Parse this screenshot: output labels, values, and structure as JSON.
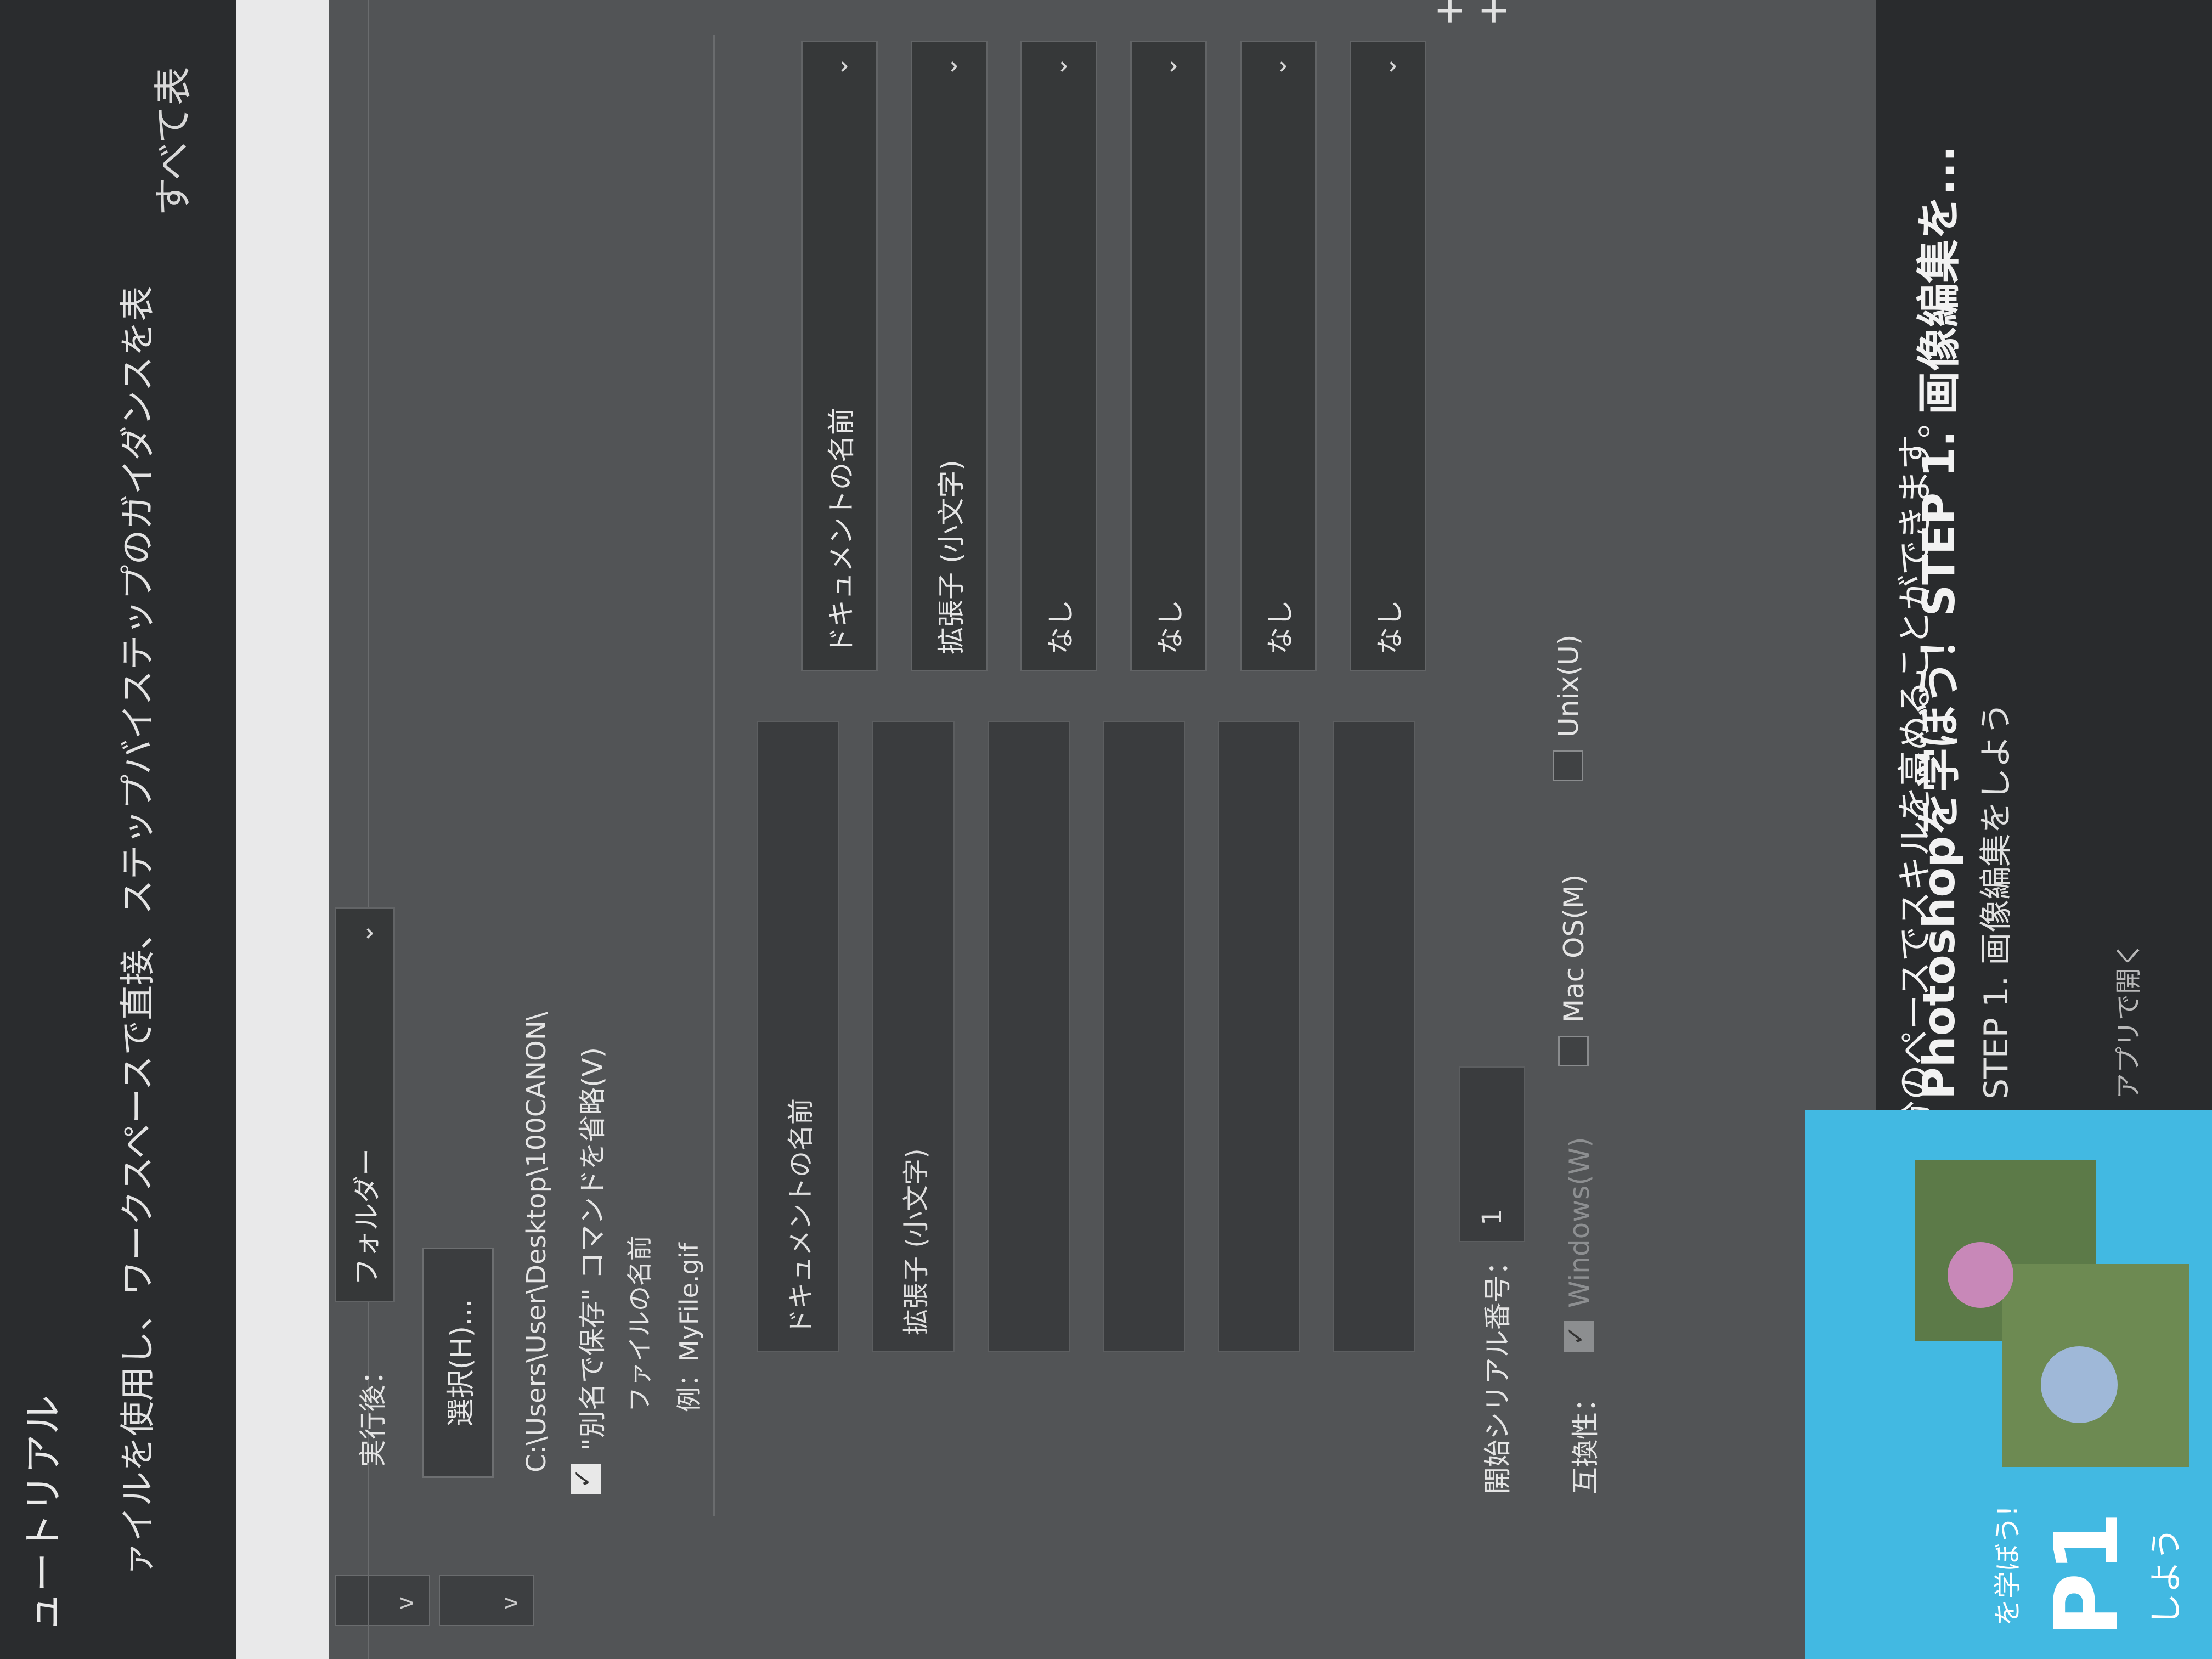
{
  "tutorial": {
    "title": "ュートリアル",
    "line": "ァイルを使用し、ワークスペースで直接、ステップバイステップのガイダンスを表",
    "show_all": "すべて表"
  },
  "dialog": {
    "after_label": "実行後：",
    "after_value": "フォルダー",
    "select_button": "選択(H)...",
    "path": "C:\\Users\\User\\Desktop\\100CANON\\",
    "skip_save_as_label": "\"別名で保存\" コマンドを省略(V)",
    "file_name_label": "ファイルの名前",
    "example": "例：MyFile.gif",
    "name_fields": [
      {
        "left_value": "ドキュメントの名前",
        "right_value": "ドキュメントの名前"
      },
      {
        "left_value": "拡張子 (小文字)",
        "right_value": "拡張子 (小文字)"
      },
      {
        "left_value": "",
        "right_value": "なし"
      },
      {
        "left_value": "",
        "right_value": "なし"
      },
      {
        "left_value": "",
        "right_value": "なし"
      },
      {
        "left_value": "",
        "right_value": "なし"
      }
    ],
    "serial_label": "開始シリアル番号：",
    "serial_value": "1",
    "compat_label": "互換性：",
    "compat_windows": "Windows(W)",
    "compat_mac": "Mac OS(M)",
    "compat_unix": "Unix(U)"
  },
  "info": {
    "text": "ョンのコンテンツを表示して、自分のペースでスキルを高めることができます。"
  },
  "banner": {
    "thumb_small": "を学ぼう!",
    "thumb_big": "P1",
    "thumb_bottom": "しよう",
    "title": "Photoshopを学ぼう！STEP 1. 画像編集を...",
    "subtitle": "STEP 1. 画像編集をしよう",
    "app_text": "アプリで開く"
  },
  "colors": {
    "dialog_bg": "#525456",
    "field_bg": "#3a3c3e",
    "banner_blue": "#42b9e2"
  }
}
